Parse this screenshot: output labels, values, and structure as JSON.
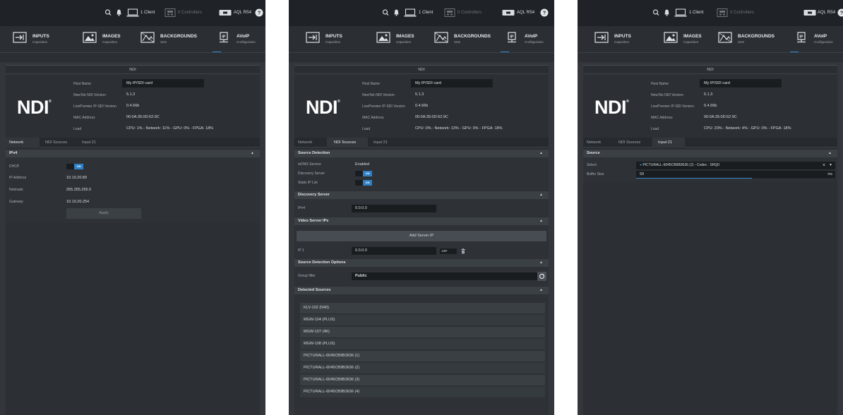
{
  "topbar": {
    "client_label": "1 Client",
    "controllers_label": "0 Controllers",
    "device_label": "AQL RS4"
  },
  "nav": {
    "inputs": {
      "title": "INPUTS",
      "subtitle": "Capacities"
    },
    "images": {
      "title": "IMAGES",
      "subtitle": "Capacities"
    },
    "backgrounds": {
      "title": "BACKGROUNDS",
      "subtitle": "Sets"
    },
    "avoip": {
      "title": "AVoIP",
      "subtitle": "Configuration"
    }
  },
  "ndi_title": "NDI",
  "logo_text": "NDI",
  "info": {
    "host_name_label": "Host Name",
    "host_name_value": "My IP/SDI card",
    "newtek_label": "NewTek NDI Version",
    "newtek_value": "5.1.3",
    "lp_label": "LivePremier IP-SDI Version",
    "lp_value": "0.4.66b",
    "mac_label": "MAC Address",
    "mac_value": "00:0A:35:0D:62:9C",
    "load_label": "Load"
  },
  "loads": [
    "CPU: 1% - Network: 11% - GPU: 0% - FPGA: 18%",
    "CPU: 0% - Network: 13% - GPU: 0% - FPGA: 18%",
    "CPU: 20% - Network: 4% - GPU: 0% - FPGA: 18%"
  ],
  "tabs": {
    "network": "Network",
    "ndi_sources": "NDI Sources",
    "input21": "Input 21"
  },
  "network": {
    "ipv4_header": "IPv4",
    "dhcp_label": "DHCP",
    "dhcp_state": "ON",
    "ip_label": "IP Address",
    "ip_value": "10.10.20.89",
    "netmask_label": "Netmask",
    "netmask_value": "255.255.255.0",
    "gateway_label": "Gateway",
    "gateway_value": "10.10.20.254",
    "apply_label": "Apply"
  },
  "sources": {
    "detection_header": "Source Detection",
    "mdns_label": "mDNS Service",
    "mdns_value": "Enabled",
    "discovery_label": "Discovery Server",
    "discovery_state": "ON",
    "static_label": "Static IP List",
    "static_state": "ON",
    "discovery_header": "Discovery Server",
    "ipv4_label": "IPv4",
    "ipv4_value": "0.0.0.0",
    "video_header": "Video Server IPs",
    "add_server_label": "Add Server IP",
    "ip1_label": "IP 1",
    "ip1_value": "0.0.0.0",
    "ip1_state": "OFF",
    "options_header": "Source Detection Options",
    "group_label": "Group filter",
    "group_value": "Public",
    "detected_header": "Detected Sources",
    "detected": [
      "KLV-102 (N40)",
      "MGW-104 (PLUS)",
      "MGW-107 (4K)",
      "MGW-108 (PLUS)",
      "PICTURALL-6045CB9B3636 (1)",
      "PICTURALL-6045CB9B3636 (2)",
      "PICTURALL-6045CB9B3636 (3)",
      "PICTURALL-6045CB9B3636 (4)"
    ]
  },
  "input": {
    "source_header": "Source",
    "select_label": "Select",
    "select_value": "PICTURALL-6045CB9B3636 (2) - Codec : SHQ0",
    "buffer_label": "Buffer Size",
    "buffer_value": "59",
    "buffer_unit": "ms",
    "buffer_fraction": 0.58
  },
  "colors": {
    "accent": "#2f7fc6",
    "panel": "#33373c",
    "topbar": "#1f2226"
  }
}
